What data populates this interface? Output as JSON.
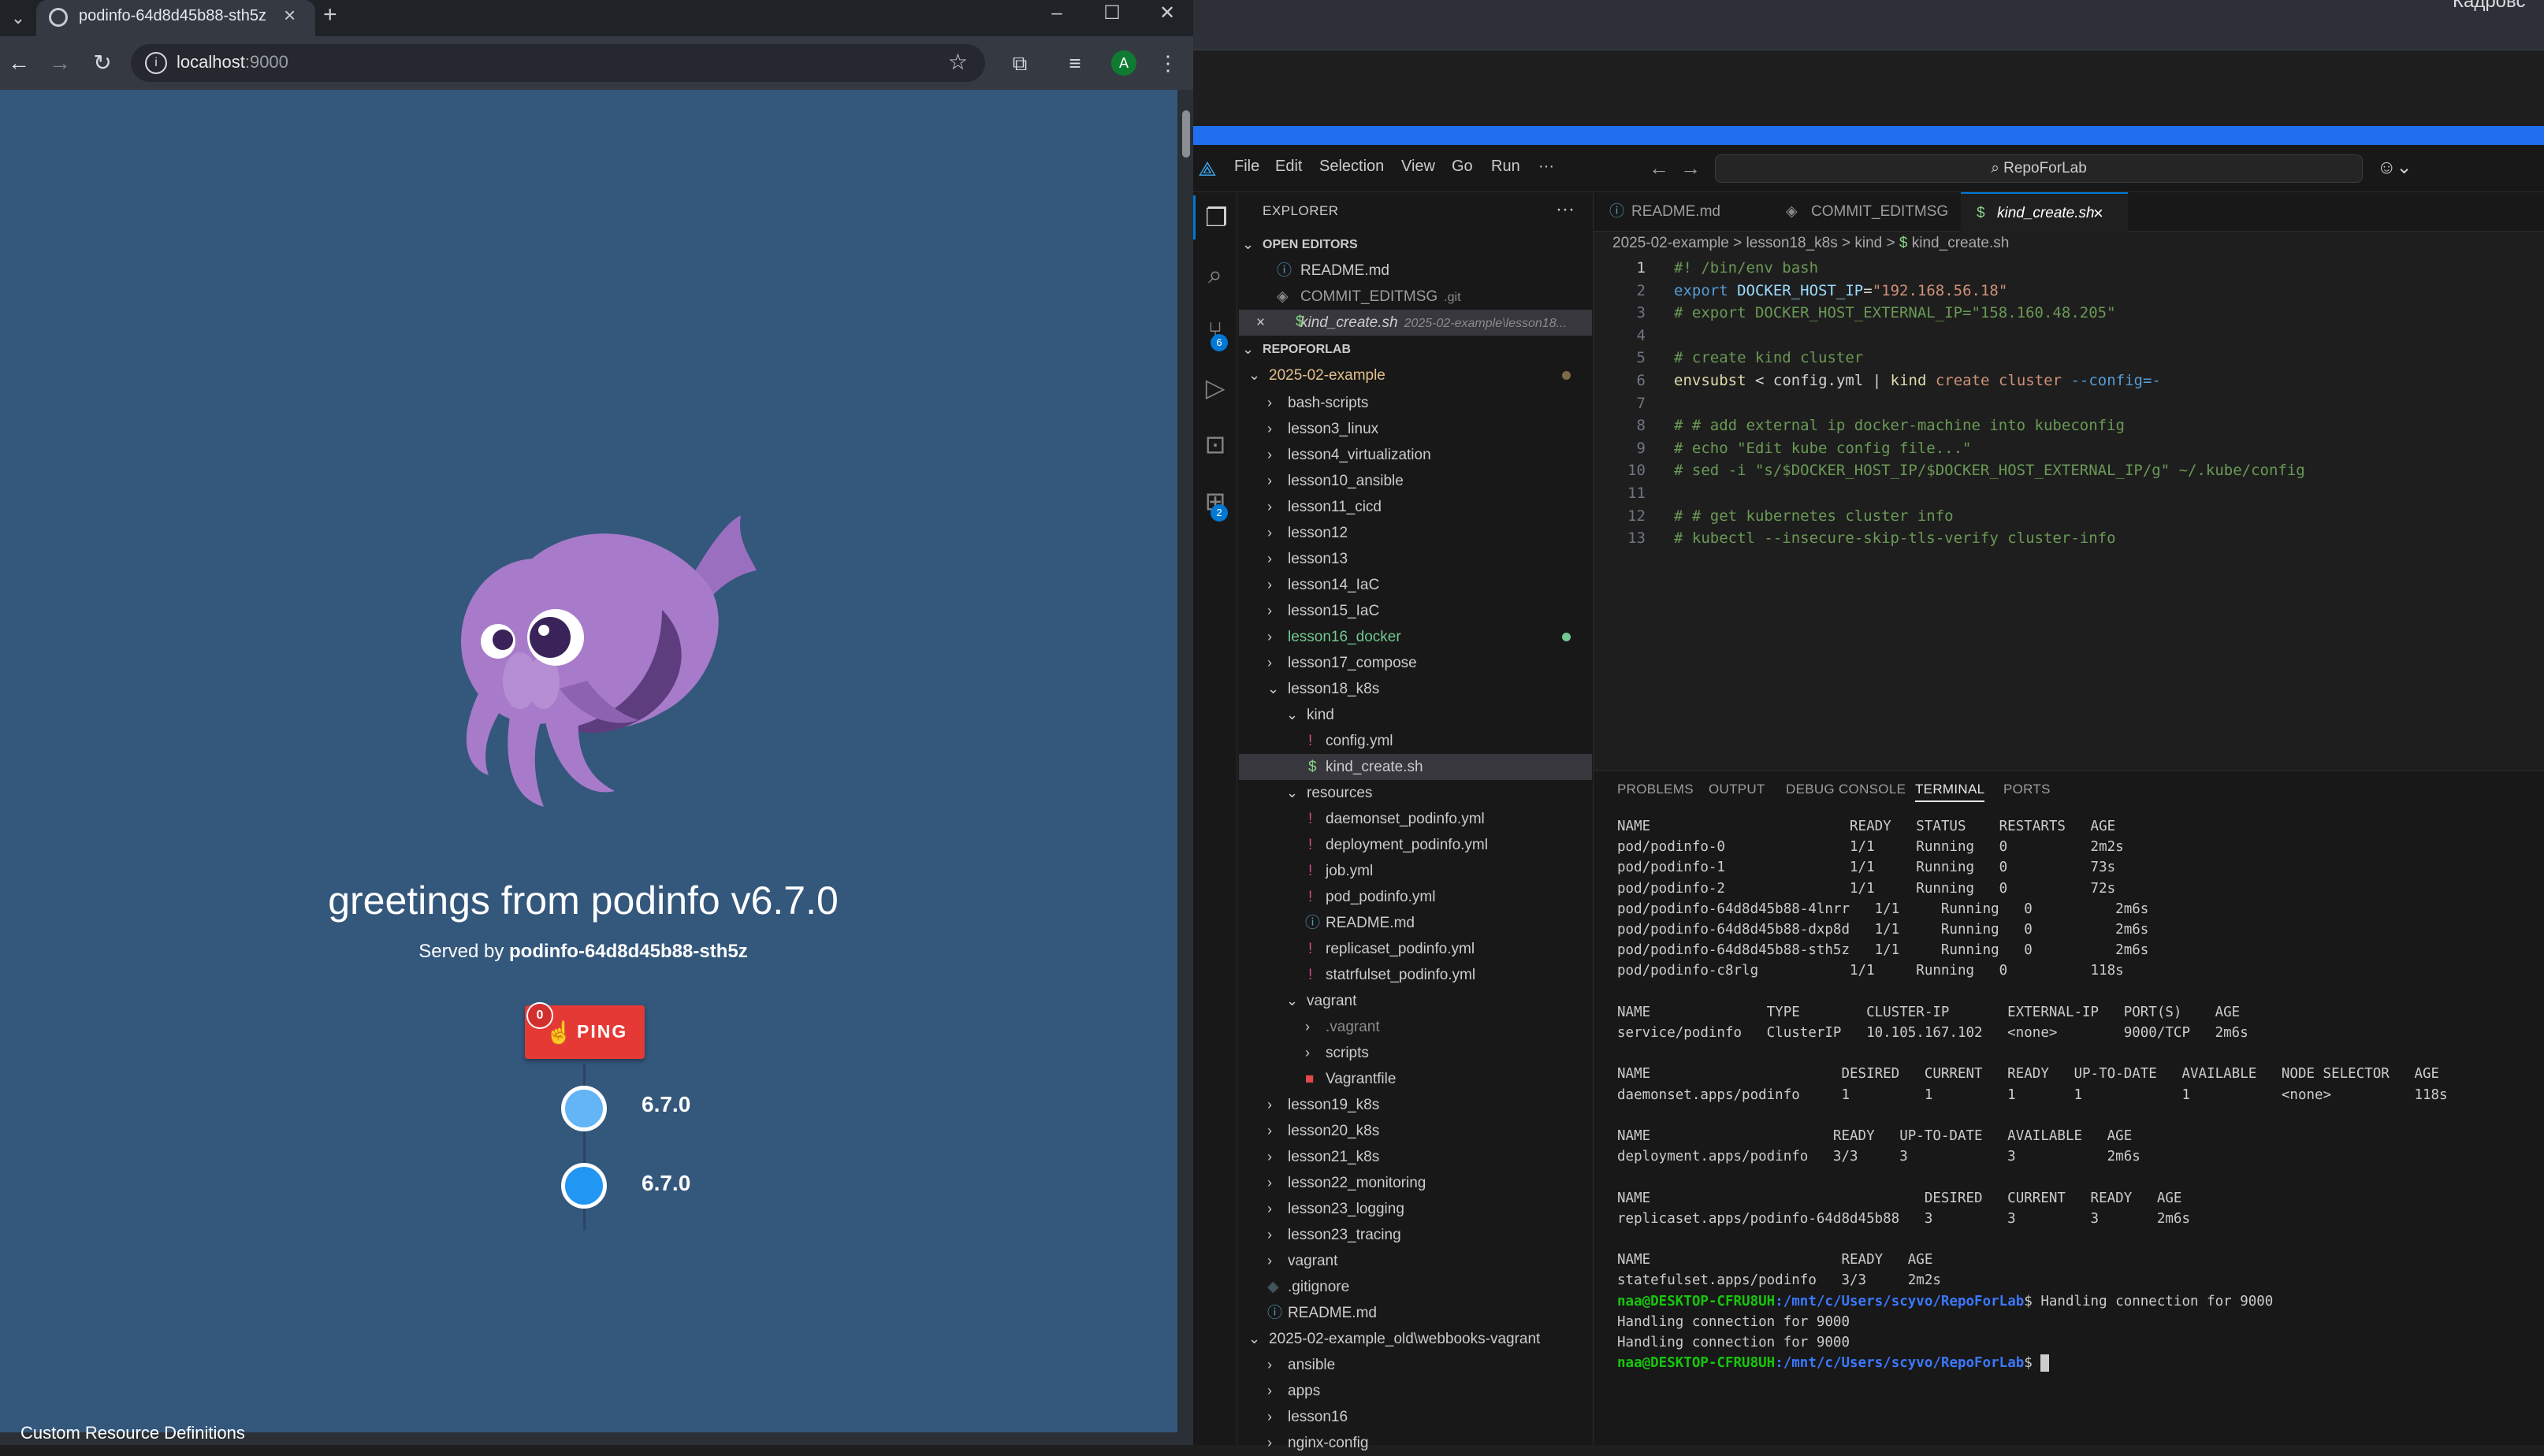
{
  "browser": {
    "tab_title": "podinfo-64d8d45b88-sth5z",
    "url_host": "localhost",
    "url_port": ":9000",
    "avatar_letter": "A",
    "page": {
      "greeting": "greetings from podinfo v6.7.0",
      "served_prefix": "Served by ",
      "served_pod": "podinfo-64d8d45b88-sth5z",
      "ping_label": "PING",
      "ping_count": "0",
      "versions": [
        "6.7.0",
        "6.7.0"
      ],
      "footer_text": "Custom Resource Definitions"
    }
  },
  "right_top": {
    "partial_text": "Кадровс"
  },
  "vscode": {
    "menu": [
      "File",
      "Edit",
      "Selection",
      "View",
      "Go",
      "Run",
      "···"
    ],
    "command_center": "RepoForLab",
    "activity_badges": {
      "source_control": "6",
      "extensions": "2"
    },
    "explorer": {
      "title": "EXPLORER",
      "open_editors_label": "OPEN EDITORS",
      "open_editors": [
        {
          "name": "README.md",
          "desc": ""
        },
        {
          "name": "COMMIT_EDITMSG",
          "desc": ".git"
        },
        {
          "name": "kind_create.sh",
          "desc": "2025-02-example\\lesson18..."
        }
      ],
      "repo_label": "REPOFORLAB",
      "tree": [
        "2025-02-example",
        "bash-scripts",
        "lesson3_linux",
        "lesson4_virtualization",
        "lesson10_ansible",
        "lesson11_cicd",
        "lesson12",
        "lesson13",
        "lesson14_IaC",
        "lesson15_IaC",
        "lesson16_docker",
        "lesson17_compose",
        "lesson18_k8s",
        "kind",
        "config.yml",
        "kind_create.sh",
        "resources",
        "daemonset_podinfo.yml",
        "deployment_podinfo.yml",
        "job.yml",
        "pod_podinfo.yml",
        "README.md",
        "replicaset_podinfo.yml",
        "statrfulset_podinfo.yml",
        "vagrant",
        ".vagrant",
        "scripts",
        "Vagrantfile",
        "lesson19_k8s",
        "lesson20_k8s",
        "lesson21_k8s",
        "lesson22_monitoring",
        "lesson23_logging",
        "lesson23_tracing",
        "vagrant",
        ".gitignore",
        "README.md",
        "2025-02-example_old\\webbooks-vagrant",
        "ansible",
        "apps",
        "lesson16",
        "nginx-config"
      ]
    },
    "editor_tabs": [
      "README.md",
      "COMMIT_EDITMSG",
      "kind_create.sh"
    ],
    "breadcrumbs": [
      "2025-02-example",
      "lesson18_k8s",
      "kind",
      "kind_create.sh"
    ],
    "code_lines": [
      "#! /bin/env bash",
      "export DOCKER_HOST_IP=\"192.168.56.18\"",
      "# export DOCKER_HOST_EXTERNAL_IP=\"158.160.48.205\"",
      "",
      "# create kind cluster",
      "envsubst < config.yml | kind create cluster --config=-",
      "",
      "# # add external ip docker-machine into kubeconfig",
      "# echo \"Edit kube config file...\"",
      "# sed -i \"s/$DOCKER_HOST_IP/$DOCKER_HOST_EXTERNAL_IP/g\" ~/.kube/config",
      "",
      "# # get kubernetes cluster info",
      "# kubectl --insecure-skip-tls-verify cluster-info"
    ],
    "panel_tabs": [
      "PROBLEMS",
      "OUTPUT",
      "DEBUG CONSOLE",
      "TERMINAL",
      "PORTS"
    ],
    "terminal": {
      "lines": [
        "NAME                        READY   STATUS    RESTARTS   AGE",
        "pod/podinfo-0               1/1     Running   0          2m2s",
        "pod/podinfo-1               1/1     Running   0          73s",
        "pod/podinfo-2               1/1     Running   0          72s",
        "pod/podinfo-64d8d45b88-4lnrr   1/1     Running   0          2m6s",
        "pod/podinfo-64d8d45b88-dxp8d   1/1     Running   0          2m6s",
        "pod/podinfo-64d8d45b88-sth5z   1/1     Running   0          2m6s",
        "pod/podinfo-c8rlg           1/1     Running   0          118s",
        "",
        "NAME              TYPE        CLUSTER-IP       EXTERNAL-IP   PORT(S)    AGE",
        "service/podinfo   ClusterIP   10.105.167.102   <none>        9000/TCP   2m6s",
        "",
        "NAME                       DESIRED   CURRENT   READY   UP-TO-DATE   AVAILABLE   NODE SELECTOR   AGE",
        "daemonset.apps/podinfo     1         1         1       1            1           <none>          118s",
        "",
        "NAME                      READY   UP-TO-DATE   AVAILABLE   AGE",
        "deployment.apps/podinfo   3/3     3            3           2m6s",
        "",
        "NAME                                 DESIRED   CURRENT   READY   AGE",
        "replicaset.apps/podinfo-64d8d45b88   3         3         3       2m6s",
        "",
        "NAME                       READY   AGE",
        "statefulset.apps/podinfo   3/3     2m2s"
      ],
      "prompt_user": "naa@DESKTOP-CFRU8UH",
      "prompt_path": ":/mnt/c/Users/scyvo/RepoForLab",
      "prompt_line1_suffix": "$ Handling connection for 9000",
      "plain_after": [
        "Handling connection for 9000",
        "Handling connection for 9000"
      ],
      "prompt_line_final_suffix": "$ "
    }
  },
  "colors": {
    "page_bg": "#34577c",
    "octopus": "#a77bc9",
    "ping": "#e53935",
    "dot1": "#64b5f6",
    "dot2": "#2196f3",
    "accent": "#0078d4",
    "git_modified": "#e2c08d",
    "git_added": "#73c991"
  }
}
